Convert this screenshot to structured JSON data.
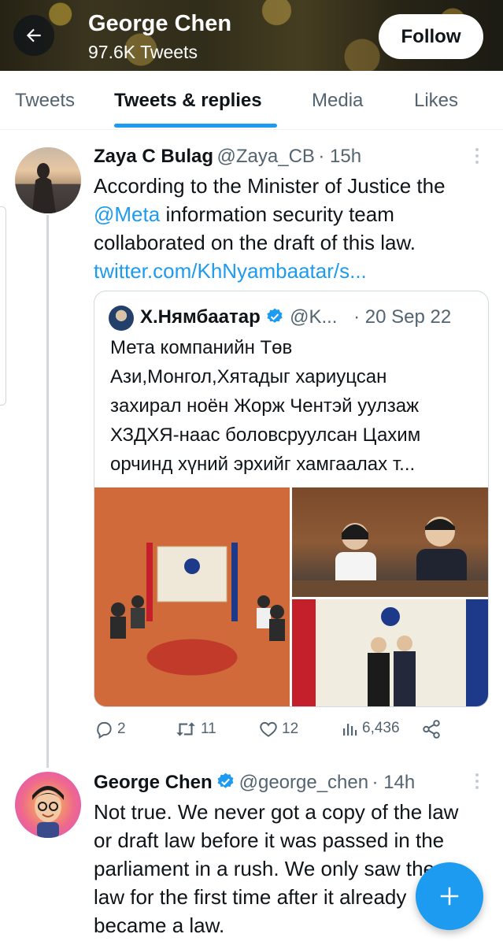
{
  "header": {
    "name": "George Chen",
    "tweet_count": "97.6K Tweets",
    "follow_label": "Follow"
  },
  "tabs": [
    {
      "label": "Tweets",
      "active": false
    },
    {
      "label": "Tweets & replies",
      "active": true
    },
    {
      "label": "Media",
      "active": false
    },
    {
      "label": "Likes",
      "active": false
    }
  ],
  "tweet1": {
    "name": "Zaya C Bulag",
    "handle": "@Zaya_CB",
    "time": "· 15h",
    "lines": [
      "According to the Minister of Justice the",
      "information security team",
      "collaborated on the draft of this law."
    ],
    "mention": "@Meta",
    "link": "twitter.com/KhNyambaatar/s...",
    "quote": {
      "name": "Х.Нямбаатар",
      "handle": "@K...",
      "date": "· 20 Sep 22",
      "lines": [
        "Мета компанийн Төв",
        "Ази,Монгол,Хятадыг хариуцсан",
        "захирал ноён Жорж Чентэй уулзаж",
        "ХЗДХЯ-наас боловсруулсан Цахим",
        "орчинд хүний эрхийг хамгаалах т..."
      ]
    },
    "actions": {
      "replies": "2",
      "retweets": "11",
      "likes": "12",
      "views": "6,436"
    }
  },
  "tweet2": {
    "name": "George Chen",
    "handle": "@george_chen",
    "time": "· 14h",
    "lines": [
      "Not true. We never got a copy of the law",
      "or draft law before it was passed in the",
      "parliament in a rush. We only saw the",
      "law for the first time after it already",
      "became a law."
    ]
  },
  "colors": {
    "accent": "#1d9bf0",
    "text": "#0f1419",
    "secondary": "#536471"
  }
}
